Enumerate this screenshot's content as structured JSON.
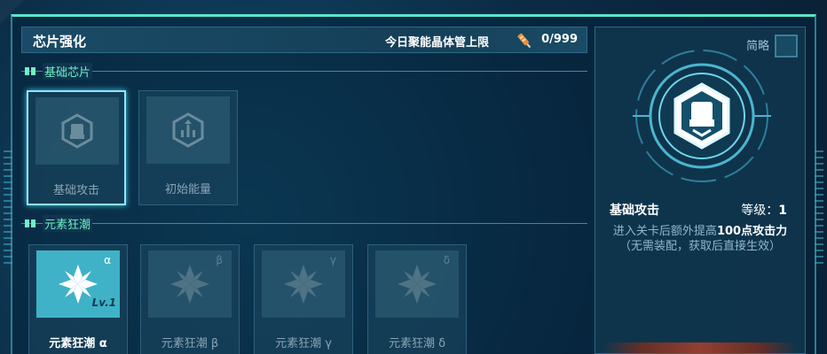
{
  "header": {
    "title": "芯片强化",
    "limit_label": "今日聚能晶体管上限",
    "limit_value": "0/999"
  },
  "sections": {
    "basic": {
      "name": "基础芯片",
      "chips": [
        {
          "label": "基础攻击",
          "icon": "fist-icon"
        },
        {
          "label": "初始能量",
          "icon": "energy-icon"
        }
      ]
    },
    "element": {
      "name": "元素狂潮",
      "chips": [
        {
          "label": "元素狂潮 α",
          "greek": "α",
          "level": "Lv.1",
          "icon": "snowflake-icon"
        },
        {
          "label": "元素狂潮 β",
          "greek": "β",
          "icon": "snowflake-icon"
        },
        {
          "label": "元素狂潮 γ",
          "greek": "γ",
          "icon": "snowflake-icon"
        },
        {
          "label": "元素狂潮 δ",
          "greek": "δ",
          "icon": "snowflake-icon"
        }
      ]
    }
  },
  "detail": {
    "brief_label": "简略",
    "name": "基础攻击",
    "level_label": "等级：",
    "level_value": "1",
    "desc_pre": "进入关卡后额外提高",
    "desc_highlight": "100点攻击力",
    "desc_line2": "（无需装配，获取后直接生效）"
  },
  "colors": {
    "accent_green": "#6ff0c3",
    "frame_top": "#5be5c9",
    "active_chip": "#3fb2c7",
    "selected_border": "#8de8ff"
  }
}
